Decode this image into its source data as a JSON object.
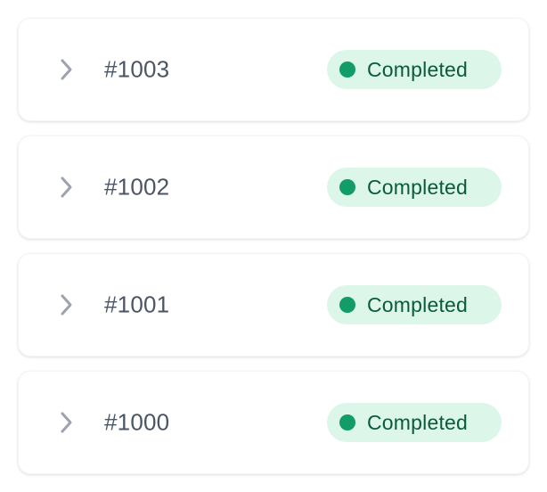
{
  "colors": {
    "badge_bg": "#dcf7ea",
    "badge_dot": "#129c67",
    "badge_text": "#0b5a3b",
    "order_text": "#4b5563",
    "chevron": "#9ca3af"
  },
  "orders": [
    {
      "id": "#1003",
      "status": "Completed",
      "icon": "chevron-right-icon"
    },
    {
      "id": "#1002",
      "status": "Completed",
      "icon": "chevron-right-icon"
    },
    {
      "id": "#1001",
      "status": "Completed",
      "icon": "chevron-right-icon"
    },
    {
      "id": "#1000",
      "status": "Completed",
      "icon": "chevron-right-icon"
    }
  ]
}
